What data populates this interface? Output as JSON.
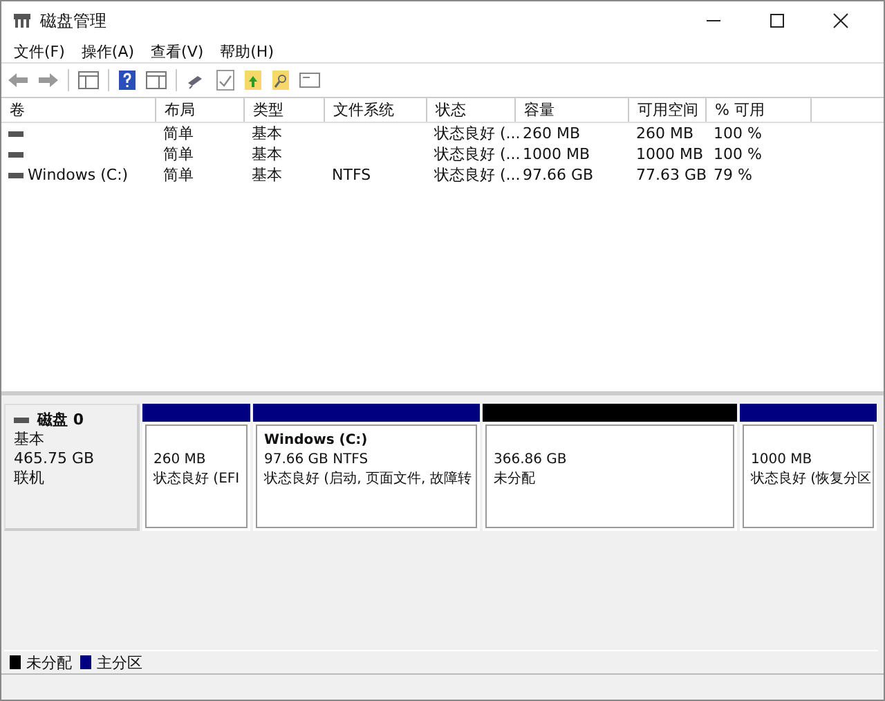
{
  "window": {
    "title": "磁盘管理"
  },
  "menu": [
    "文件(F)",
    "操作(A)",
    "查看(V)",
    "帮助(H)"
  ],
  "table": {
    "columns": [
      "卷",
      "布局",
      "类型",
      "文件系统",
      "状态",
      "容量",
      "可用空间",
      "% 可用"
    ],
    "rows": [
      {
        "layout": "简单",
        "type": "基本",
        "status": "状态良好 (...",
        "capacity": "260 MB",
        "free": "260 MB",
        "percent_free": "100 %"
      },
      {
        "layout": "简单",
        "type": "基本",
        "status": "状态良好 (...",
        "capacity": "1000 MB",
        "free": "1000 MB",
        "percent_free": "100 %"
      },
      {
        "volume": "Windows (C:)",
        "layout": "简单",
        "type": "基本",
        "filesystem": "NTFS",
        "status": "状态良好 (...",
        "capacity": "97.66 GB",
        "free": "77.63 GB",
        "percent_free": "79 %"
      }
    ]
  },
  "disk": {
    "name": "磁盘 0",
    "type": "基本",
    "size": "465.75 GB",
    "status": "联机",
    "partitions": [
      {
        "color": "#000080",
        "size": "260 MB",
        "status": "状态良好 (EFI"
      },
      {
        "color": "#000080",
        "title": "Windows  (C:)",
        "size": "97.66 GB NTFS",
        "status": "状态良好 (启动, 页面文件, 故障转"
      },
      {
        "color": "#000000",
        "size": "366.86 GB",
        "status": "未分配"
      },
      {
        "color": "#000080",
        "size": "1000 MB",
        "status": "状态良好 (恢复分区"
      }
    ]
  },
  "legend": [
    {
      "label": "未分配",
      "color": "#000000"
    },
    {
      "label": "主分区",
      "color": "#000080"
    }
  ]
}
